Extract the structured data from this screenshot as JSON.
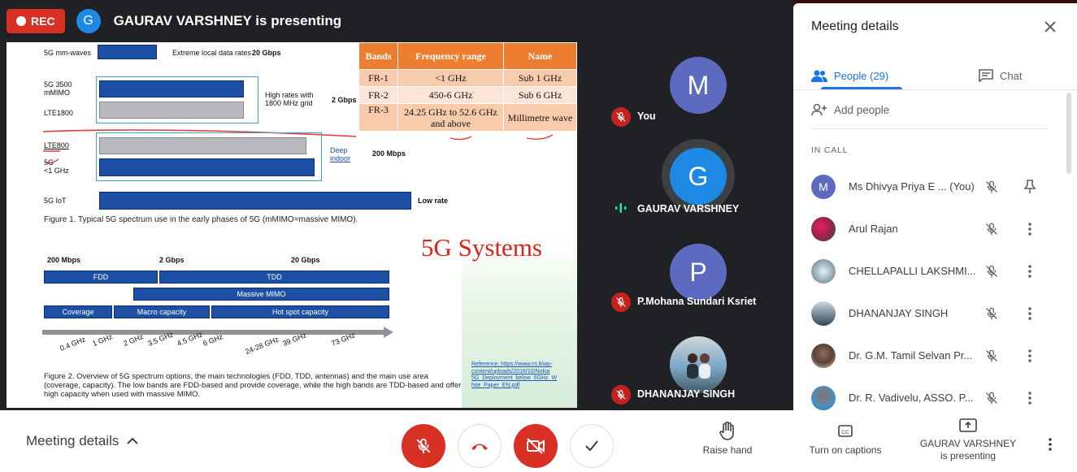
{
  "presenter_bar": {
    "rec_label": "REC",
    "avatar_initial": "G",
    "title": "GAURAV VARSHNEY is presenting"
  },
  "slide": {
    "rows": {
      "mmwaves": "5G mm-waves",
      "extreme": "Extreme local data rates",
      "rate_20": "20 Gbps",
      "r3500_a": "5G 3500",
      "r3500_b": "mMIMO",
      "lte1800": "LTE1800",
      "high_a": "High rates with",
      "high_b": "1800 MHz grid",
      "rate_2": "2 Gbps",
      "lte800": "LTE800",
      "g5_a": "5G",
      "g5_b": "<1 GHz",
      "deep_a": "Deep",
      "deep_b": "indoor",
      "rate_200": "200 Mbps",
      "iot": "5G IoT",
      "low_rate": "Low rate"
    },
    "figure1": "Figure 1. Typical 5G spectrum use in the early phases of 5G (mMIMO=massive MIMO).",
    "title": "5G Systems",
    "fig2_rates": [
      "200 Mbps",
      "2 Gbps",
      "20 Gbps"
    ],
    "fig2_bars": {
      "fdd": "FDD",
      "tdd": "TDD",
      "massive": "Massive MIMO",
      "coverage": "Coverage",
      "macro": "Macro capacity",
      "hotspot": "Hot spot capacity"
    },
    "freq_labels": [
      "0.4 GHz",
      "1 GHz",
      "2 GHz",
      "3.5 GHz",
      "4.5 GHz",
      "6 GHz",
      "24-28 GHz",
      "39 GHz",
      "73 GHz"
    ],
    "figure2": "Figure 2. Overview of 5G spectrum options, the main technologies (FDD, TDD, antennas) and the main use area (coverage, capacity). The low bands are FDD-based and provide coverage, while the high bands are TDD-based and offer high capacity when used with massive MIMO.",
    "reference": "Reference: https://www.rrt.lt/wp-content/uploads/2018/10/Nokia 5G_Deployment_below_6GHz_W hite_Paper_EN.pdf",
    "bands_table": {
      "headers": [
        "Bands",
        "Frequency range",
        "Name"
      ],
      "rows": [
        [
          "FR-1",
          "<1 GHz",
          "Sub 1 GHz"
        ],
        [
          "FR-2",
          "450-6 GHz",
          "Sub 6 GHz"
        ],
        [
          "FR-3",
          "24.25 GHz to 52.6 GHz and above",
          "Millimetre wave"
        ]
      ]
    }
  },
  "tiles": [
    {
      "initial": "M",
      "name": "You",
      "color": "#5c6bc0"
    },
    {
      "initial": "G",
      "name": "GAURAV VARSHNEY",
      "color": "#1e88e5"
    },
    {
      "initial": "P",
      "name": "P.Mohana Sundari Ksriet",
      "color": "#5c6bc0"
    },
    {
      "initial": "",
      "name": "DHANANJAY SINGH",
      "color": "#7aa6c8"
    }
  ],
  "panel": {
    "title": "Meeting details",
    "tab_people": "People (29)",
    "tab_chat": "Chat",
    "add_people": "Add people",
    "in_call": "IN CALL",
    "participants": [
      {
        "name": "Ms Dhivya Priya E ... (You)",
        "initial": "M",
        "color": "#5c6bc0"
      },
      {
        "name": "Arul Rajan",
        "initial": "",
        "color": "#c2185b"
      },
      {
        "name": "CHELLAPALLI LAKSHMI...",
        "initial": "",
        "color": "#9fb7c9"
      },
      {
        "name": "DHANANJAY SINGH",
        "initial": "",
        "color": "#6d7f8f"
      },
      {
        "name": "Dr. G.M. Tamil Selvan Pr...",
        "initial": "",
        "color": "#8d6e63"
      },
      {
        "name": "Dr. R. Vadivelu, ASSO. P...",
        "initial": "",
        "color": "#4a90c2"
      }
    ]
  },
  "bottom": {
    "meeting_details": "Meeting details",
    "raise_hand": "Raise hand",
    "captions": "Turn on captions",
    "presenting_a": "GAURAV VARSHNEY",
    "presenting_b": "is presenting"
  }
}
